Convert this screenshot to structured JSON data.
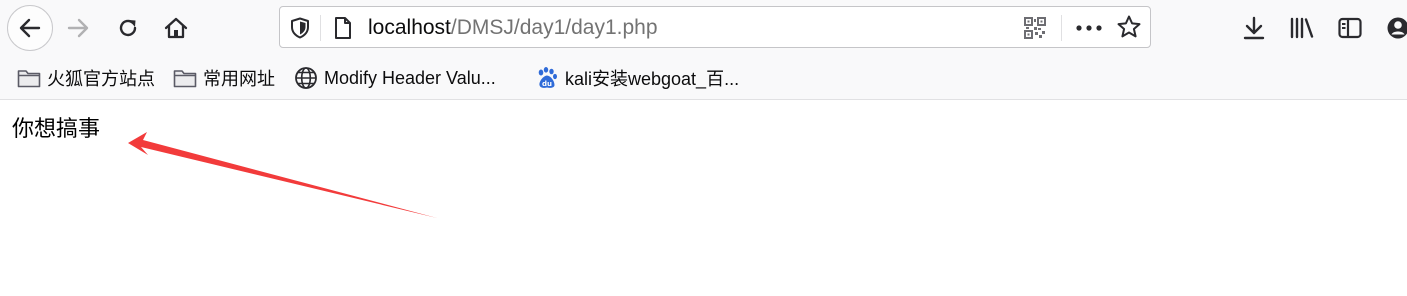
{
  "browser": {
    "url_host": "localhost",
    "url_path": "/DMSJ/day1/day1.php"
  },
  "bookmarks": [
    {
      "label": "火狐官方站点",
      "icon": "folder-icon"
    },
    {
      "label": "常用网址",
      "icon": "folder-icon"
    },
    {
      "label": "Modify Header Valu...",
      "icon": "globe-icon"
    },
    {
      "label": "kali安装webgoat_百...",
      "icon": "baidu-icon"
    }
  ],
  "page": {
    "text": "你想搞事"
  },
  "colors": {
    "arrow": "#f23b3b",
    "baidu": "#2f6bd8"
  }
}
